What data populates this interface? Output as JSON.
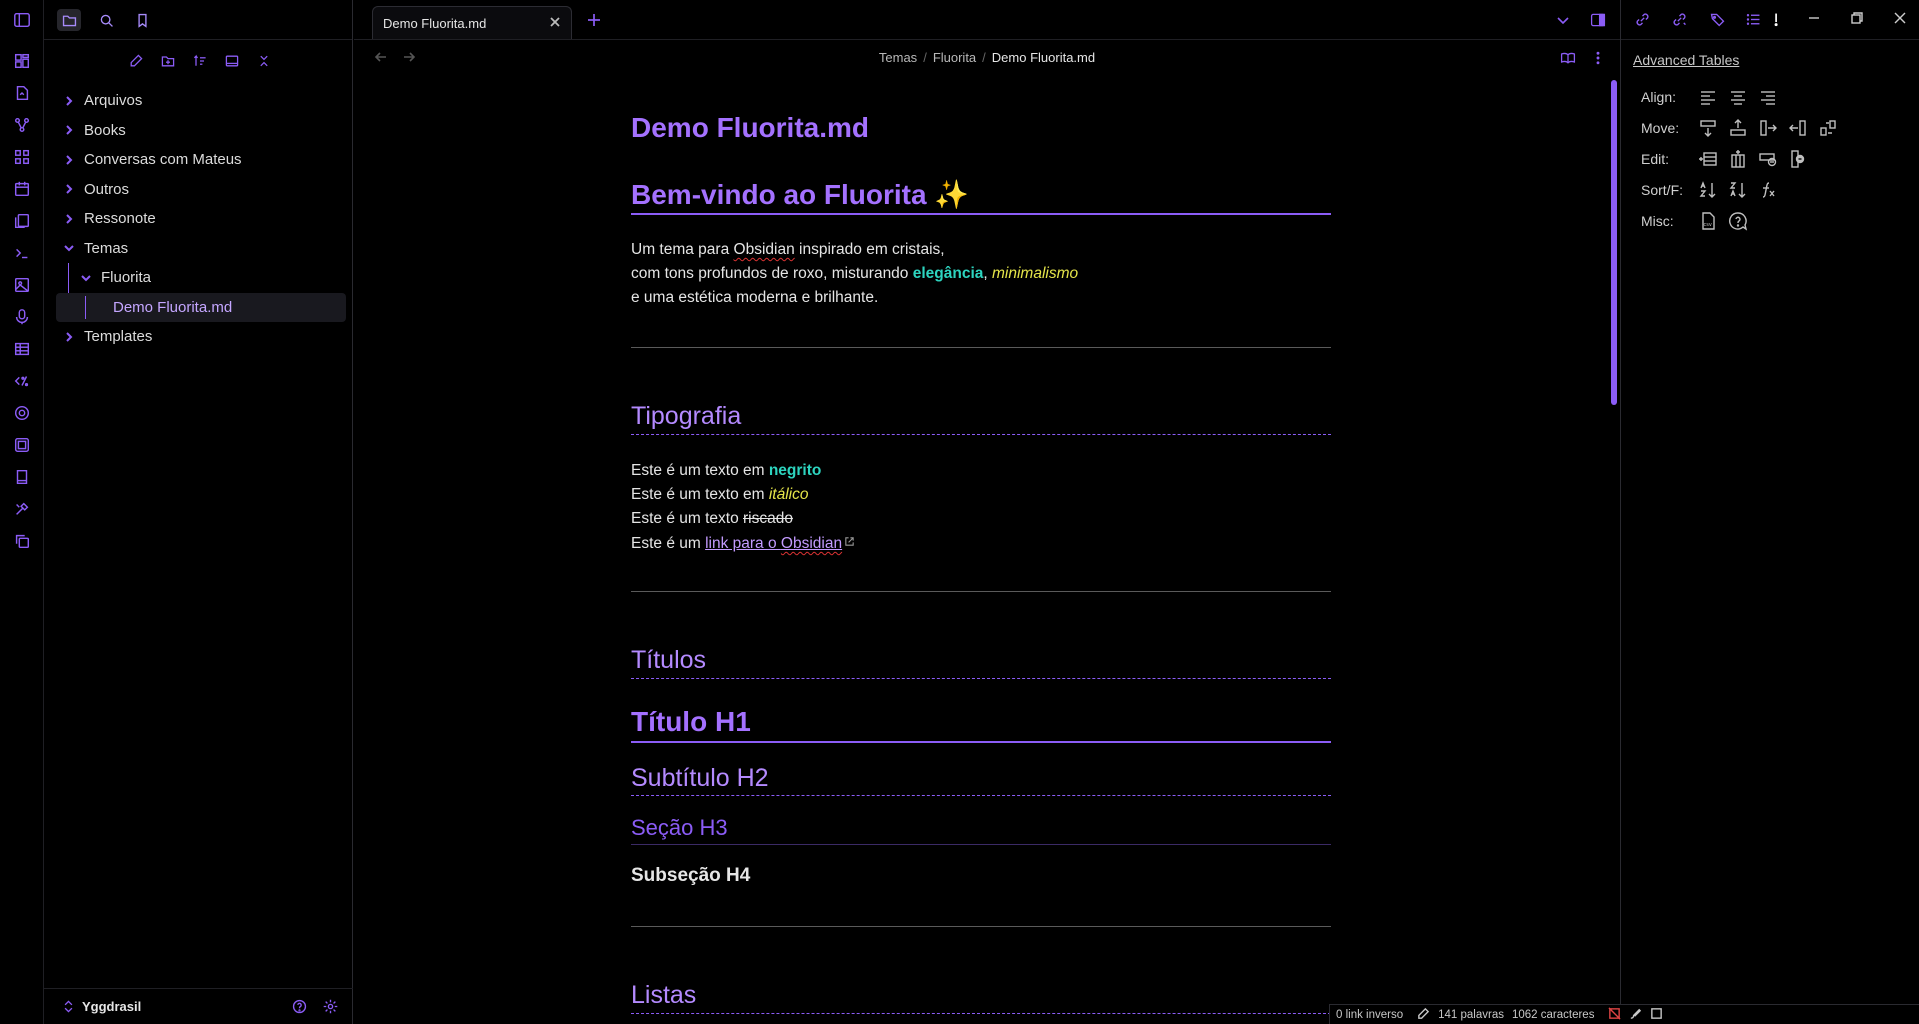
{
  "window": {
    "tab_title": "Demo Fluorita.md"
  },
  "sidebar": {
    "tree": [
      {
        "label": "Arquivos",
        "type": "folder",
        "expanded": false
      },
      {
        "label": "Books",
        "type": "folder",
        "expanded": false
      },
      {
        "label": "Conversas com Mateus",
        "type": "folder",
        "expanded": false
      },
      {
        "label": "Outros",
        "type": "folder",
        "expanded": false
      },
      {
        "label": "Ressonote",
        "type": "folder",
        "expanded": false
      },
      {
        "label": "Temas",
        "type": "folder",
        "expanded": true
      },
      {
        "label": "Fluorita",
        "type": "folder",
        "expanded": true
      },
      {
        "label": "Demo Fluorita.md",
        "type": "file",
        "active": true
      },
      {
        "label": "Templates",
        "type": "folder",
        "expanded": false
      }
    ],
    "vault_name": "Yggdrasil"
  },
  "breadcrumb": {
    "parts": [
      "Temas",
      "Fluorita"
    ],
    "current": "Demo Fluorita.md"
  },
  "doc": {
    "file_title": "Demo Fluorita.md",
    "h1": "Bem-vindo ao Fluorita ✨",
    "intro_l1_a": "Um tema para ",
    "intro_l1_b": "Obsidian",
    "intro_l1_c": " inspirado em cristais,",
    "intro_l2_a": "com tons profundos de roxo, misturando ",
    "intro_l2_b": "elegância",
    "intro_l2_c": ", ",
    "intro_l2_d": "minimalismo",
    "intro_l3": "e uma estética moderna e brilhante.",
    "tipografia": "Tipografia",
    "t1_a": "Este é um texto em ",
    "t1_b": "negrito",
    "t2_a": "Este é um texto em ",
    "t2_b": "itálico",
    "t3_a": "Este é um texto ",
    "t3_b": "riscado",
    "t4_a": "Este é um ",
    "t4_b": "link para o ",
    "t4_c": "Obsidian",
    "titulos": "Títulos",
    "h1_demo": "Título H1",
    "h2_demo": "Subtítulo H2",
    "h3_demo": "Seção H3",
    "h4_demo": "Subseção H4",
    "listas": "Listas"
  },
  "advanced_tables": {
    "title": "Advanced Tables",
    "rows": [
      "Align:",
      "Move:",
      "Edit:",
      "Sort/F:",
      "Misc:"
    ]
  },
  "status": {
    "backlinks": "0 link inverso",
    "words": "141 palavras",
    "chars": "1062 caracteres"
  },
  "colors": {
    "accent": "#8b5cf6",
    "heading": "#a471ff",
    "teal": "#2dd4bf",
    "yellow": "#e5e54a"
  }
}
